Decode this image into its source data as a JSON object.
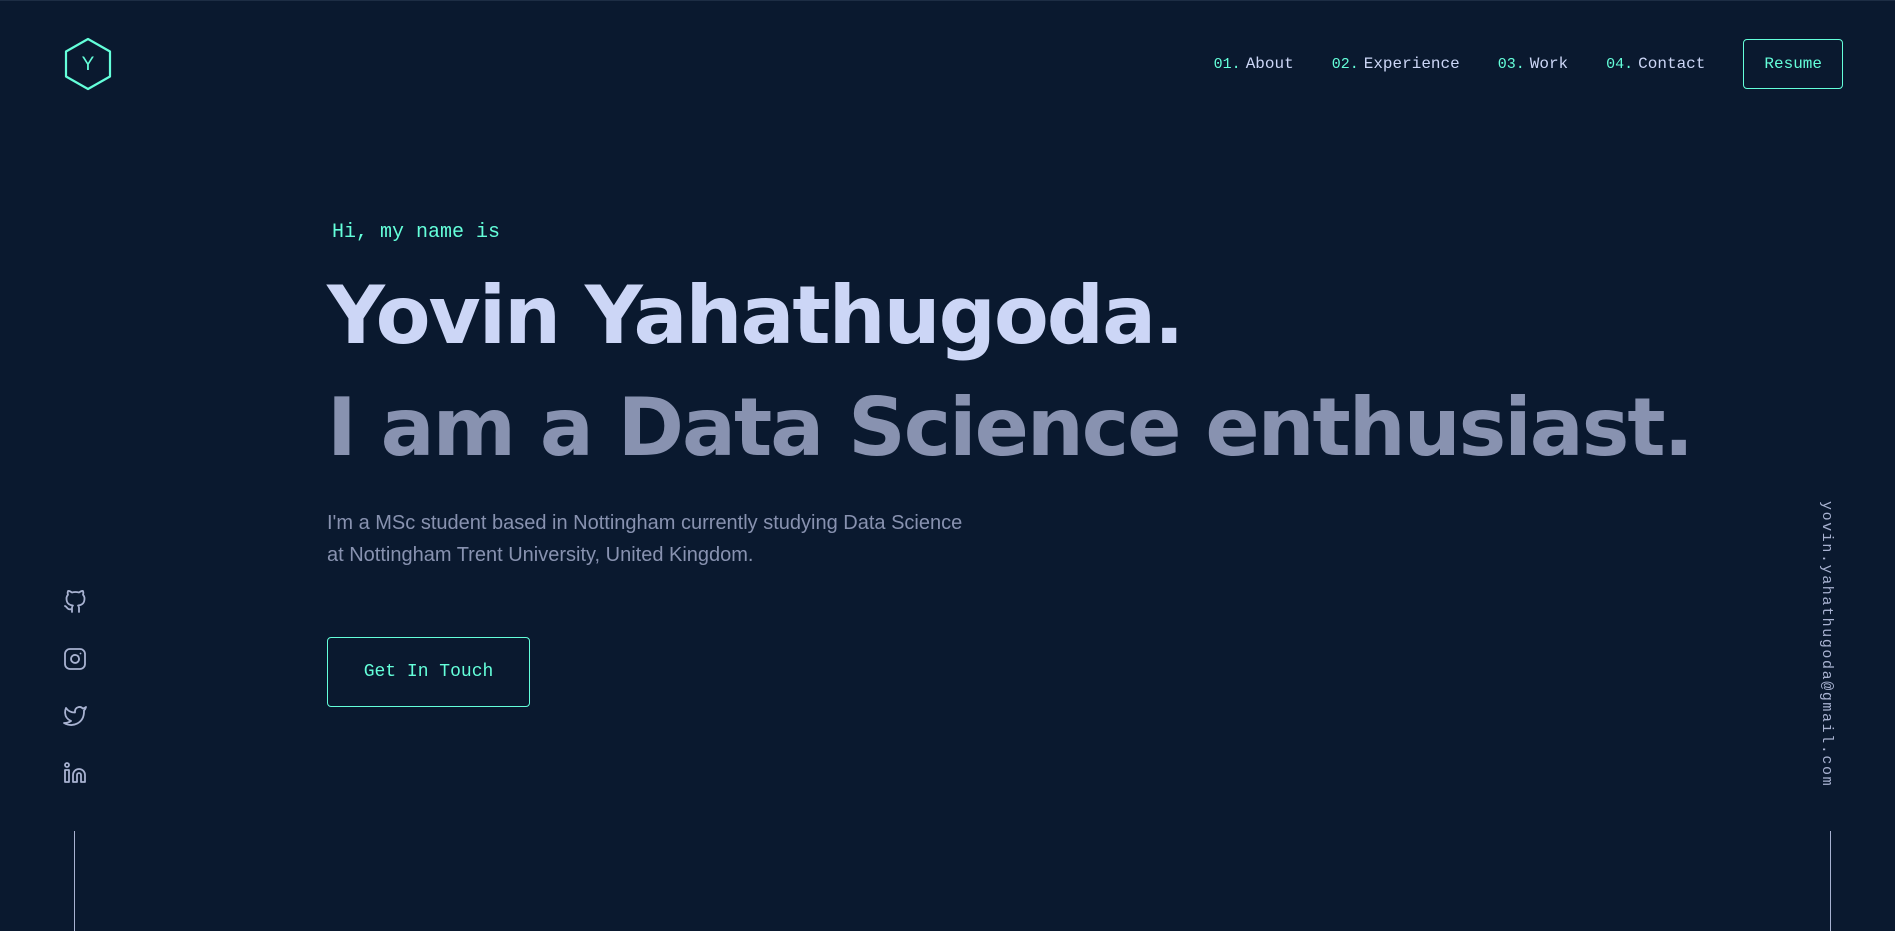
{
  "header": {
    "logo_letter": "Y",
    "nav": [
      {
        "num": "01.",
        "label": "About"
      },
      {
        "num": "02.",
        "label": "Experience"
      },
      {
        "num": "03.",
        "label": "Work"
      },
      {
        "num": "04.",
        "label": "Contact"
      }
    ],
    "resume_label": "Resume"
  },
  "hero": {
    "greeting": "Hi, my name is",
    "name": "Yovin Yahathugoda.",
    "tagline": "I am a Data Science enthusiast.",
    "intro": "I'm a MSc student based in Nottingham currently studying Data Science at Nottingham Trent University, United Kingdom.",
    "cta_label": "Get In Touch"
  },
  "socials": [
    {
      "icon": "github-icon"
    },
    {
      "icon": "instagram-icon"
    },
    {
      "icon": "twitter-icon"
    },
    {
      "icon": "linkedin-icon"
    }
  ],
  "email": "yovin.yahathugoda@gmail.com",
  "colors": {
    "background": "#0a192f",
    "accent": "#64ffda",
    "heading": "#ccd6f6",
    "muted": "#8892b0",
    "light": "#a8b2d1"
  }
}
